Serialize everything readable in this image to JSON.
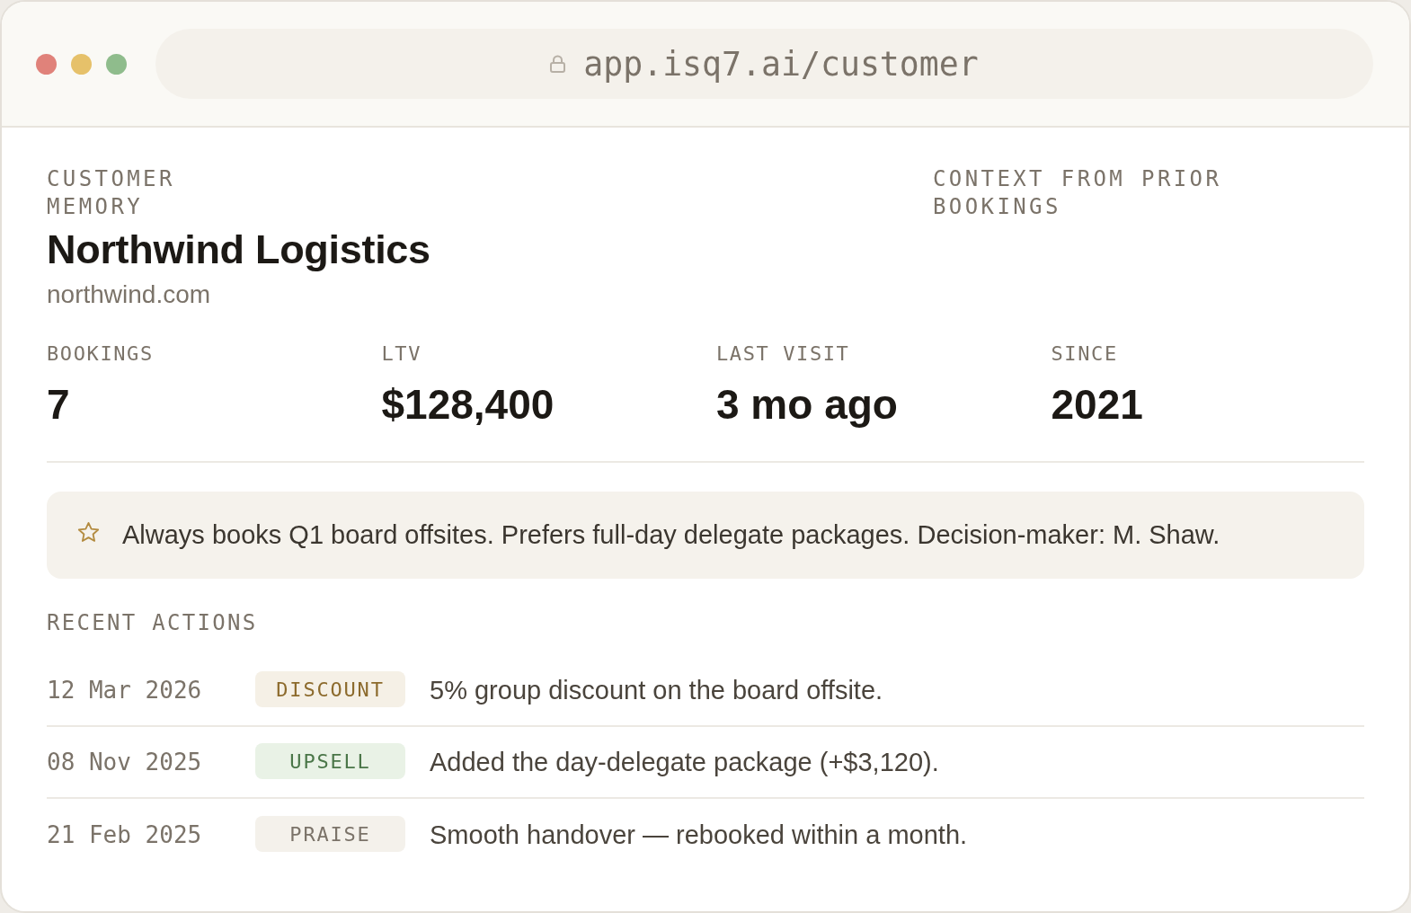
{
  "window": {
    "address": "app.isq7.ai/customer"
  },
  "header": {
    "eyebrow": "CUSTOMER MEMORY",
    "name": "Northwind Logistics",
    "domain": "northwind.com",
    "context_label": "CONTEXT FROM PRIOR BOOKINGS"
  },
  "stats": [
    {
      "label": "BOOKINGS",
      "value": "7"
    },
    {
      "label": "LTV",
      "value": "$128,400"
    },
    {
      "label": "LAST VISIT",
      "value": "3 mo ago"
    },
    {
      "label": "SINCE",
      "value": "2021"
    }
  ],
  "note": {
    "text": "Always books Q1 board offsites. Prefers full-day delegate packages. Decision-maker: M. Shaw."
  },
  "recent_actions": {
    "title": "RECENT ACTIONS",
    "rows": [
      {
        "date": "12 Mar 2026",
        "tag": "DISCOUNT",
        "kind": "discount",
        "text": "5% group discount on the board offsite."
      },
      {
        "date": "08 Nov 2025",
        "tag": "UPSELL",
        "kind": "upsell",
        "text": "Added the day-delegate package (+$3,120)."
      },
      {
        "date": "21 Feb 2025",
        "tag": "PRAISE",
        "kind": "praise",
        "text": "Smooth handover — rebooked within a month."
      }
    ]
  }
}
